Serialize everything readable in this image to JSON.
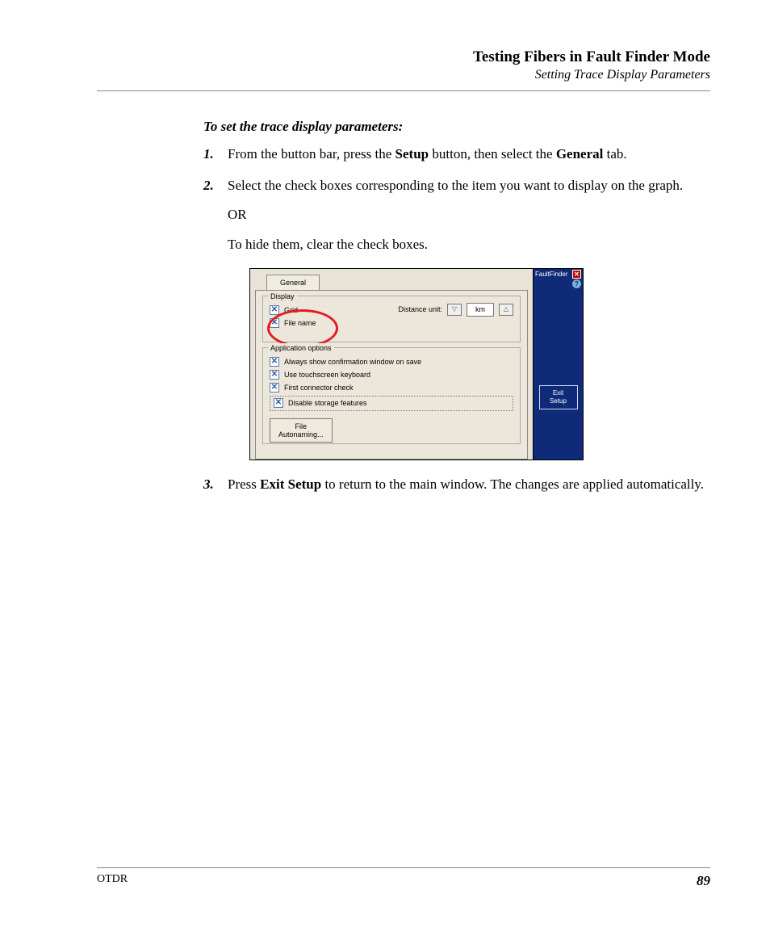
{
  "header": {
    "title": "Testing Fibers in Fault Finder Mode",
    "subtitle": "Setting Trace Display Parameters"
  },
  "procedure": {
    "heading": "To set the trace display parameters:",
    "steps": {
      "s1": {
        "num": "1.",
        "pre": "From the button bar, press the ",
        "b1": "Setup",
        "mid": " button, then select the ",
        "b2": "General",
        "post": " tab."
      },
      "s2": {
        "num": "2.",
        "line1": "Select the check boxes corresponding to the item you want to display on the graph.",
        "or": "OR",
        "line2": "To hide them, clear the check boxes."
      },
      "s3": {
        "num": "3.",
        "pre": "Press ",
        "b1": "Exit Setup",
        "post": " to return to the main window. The changes are applied automatically."
      }
    }
  },
  "screenshot": {
    "tab": "General",
    "display_group": {
      "title": "Display",
      "grid": "Grid",
      "file_name": "File name",
      "distance_unit_label": "Distance unit:",
      "unit_value": "km"
    },
    "app_group": {
      "title": "Application options",
      "o1": "Always show confirmation window on save",
      "o2": "Use touchscreen keyboard",
      "o3": "First connector check",
      "o4": "Disable storage features",
      "file_btn_l1": "File",
      "file_btn_l2": "Autonaming..."
    },
    "sidebar": {
      "app_name": "FaultFinder",
      "exit_l1": "Exit",
      "exit_l2": "Setup"
    }
  },
  "footer": {
    "product": "OTDR",
    "page": "89"
  }
}
